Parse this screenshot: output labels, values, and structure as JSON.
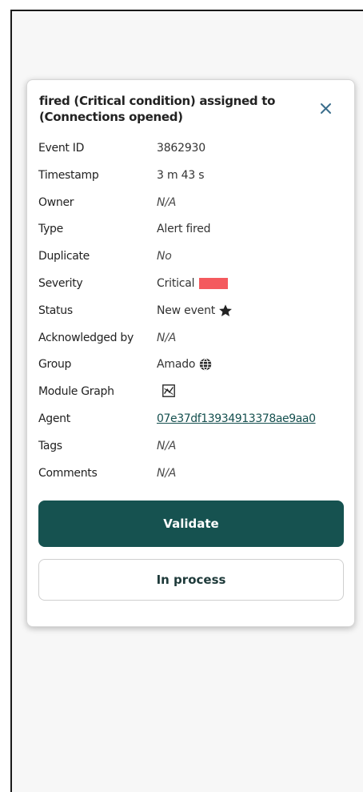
{
  "dialog": {
    "title": "fired (Critical condition) assigned to (Connections opened)",
    "close_icon": "close-icon"
  },
  "fields": [
    {
      "label": "Event ID",
      "value": "3862930"
    },
    {
      "label": "Timestamp",
      "value": "3 m 43 s"
    },
    {
      "label": "Owner",
      "value": "N/A"
    },
    {
      "label": "Type",
      "value": "Alert fired"
    },
    {
      "label": "Duplicate",
      "value": "No"
    },
    {
      "label": "Severity",
      "value": "Critical",
      "color": "#f45a5e"
    },
    {
      "label": "Status",
      "value": "New event",
      "icon": "star-icon"
    },
    {
      "label": "Acknowledged by",
      "value": "N/A"
    },
    {
      "label": "Group",
      "value": "Amado",
      "icon": "globe-icon"
    },
    {
      "label": "Module Graph",
      "value": "",
      "icon": "graph-icon"
    },
    {
      "label": "Agent",
      "value": "07e37df13934913378ae9aa0"
    },
    {
      "label": "Tags",
      "value": "N/A"
    },
    {
      "label": "Comments",
      "value": "N/A"
    }
  ],
  "actions": {
    "validate_label": "Validate",
    "in_process_label": "In process"
  },
  "colors": {
    "primary": "#165250",
    "severity_critical": "#f45a5e"
  }
}
